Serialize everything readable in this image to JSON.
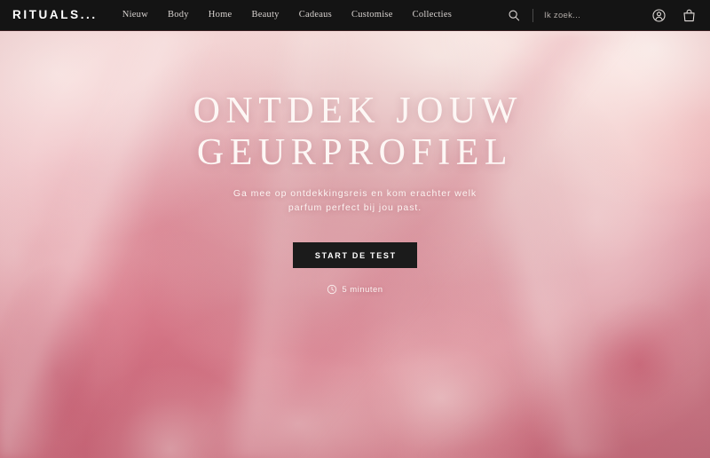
{
  "header": {
    "logo": "RITUALS...",
    "nav": [
      {
        "label": "Nieuw"
      },
      {
        "label": "Body"
      },
      {
        "label": "Home"
      },
      {
        "label": "Beauty"
      },
      {
        "label": "Cadeaus"
      },
      {
        "label": "Customise"
      },
      {
        "label": "Collecties"
      }
    ],
    "search": {
      "icon": "search-icon",
      "placeholder": "Ik zoek...",
      "value": ""
    },
    "account_icon": "account-icon",
    "bag_icon": "shopping-bag-icon",
    "background_color": "#141414"
  },
  "hero": {
    "title_line1": "ONTDEK JOUW",
    "title_line2": "GEURPROFIEL",
    "subtitle": "Ga mee op ontdekkingsreis en kom erachter welk parfum perfect bij jou past.",
    "cta_label": "START DE TEST",
    "duration_icon": "clock-icon",
    "duration_label": "5 minuten",
    "background_image_description": "close-up blurred pink peony flower",
    "accent_color": "#1b1b1b",
    "text_color": "#fdf7f5"
  }
}
